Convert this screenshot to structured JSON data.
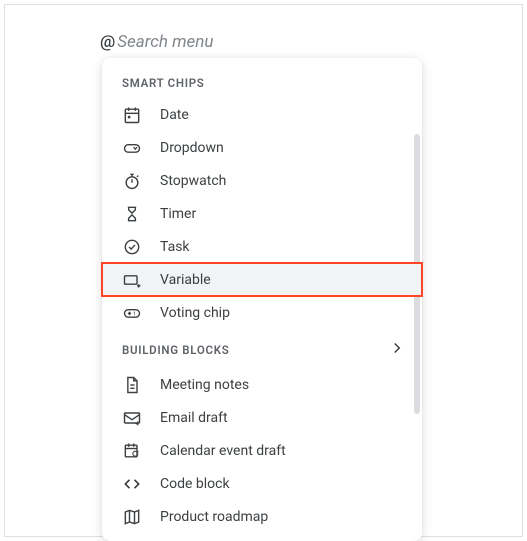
{
  "search": {
    "prefix": "@",
    "placeholder": "Search menu"
  },
  "sections": {
    "smart_chips": {
      "header": "SMART CHIPS",
      "items": [
        {
          "label": "Date"
        },
        {
          "label": "Dropdown"
        },
        {
          "label": "Stopwatch"
        },
        {
          "label": "Timer"
        },
        {
          "label": "Task"
        },
        {
          "label": "Variable"
        },
        {
          "label": "Voting chip"
        }
      ]
    },
    "building_blocks": {
      "header": "BUILDING BLOCKS",
      "items": [
        {
          "label": "Meeting notes"
        },
        {
          "label": "Email draft"
        },
        {
          "label": "Calendar event draft"
        },
        {
          "label": "Code block"
        },
        {
          "label": "Product roadmap"
        }
      ]
    }
  }
}
